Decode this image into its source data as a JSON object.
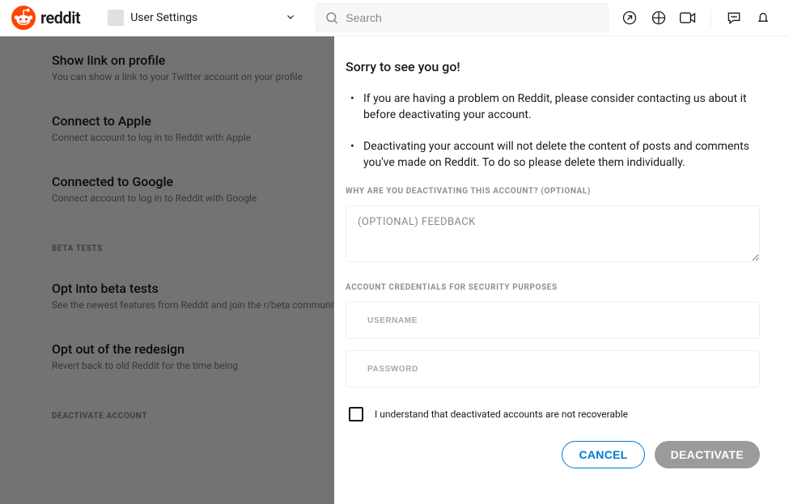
{
  "brand": {
    "name": "reddit"
  },
  "nav": {
    "label": "User Settings"
  },
  "search": {
    "placeholder": "Search"
  },
  "settings": {
    "item0": {
      "title": "Show link on profile",
      "desc": "You can show a link to your Twitter account on your profile"
    },
    "item1": {
      "title": "Connect to Apple",
      "desc": "Connect account to log in to Reddit with Apple"
    },
    "item2": {
      "title": "Connected to Google",
      "desc": "Connect account to log in to Reddit with Google"
    },
    "section_beta": "BETA TESTS",
    "item3": {
      "title": "Opt into beta tests",
      "desc": "See the newest features from Reddit and join the r/beta community"
    },
    "item4": {
      "title": "Opt out of the redesign",
      "desc": "Revert back to old Reddit for the time being"
    },
    "section_deactivate": "DEACTIVATE ACCOUNT"
  },
  "modal": {
    "title": "Sorry to see you go!",
    "bullet1": "If you are having a problem on Reddit, please consider contacting us about it before deactivating your account.",
    "bullet2": "Deactivating your account will not delete the content of posts and comments you've made on Reddit. To do so please delete them individually.",
    "feedback_label": "WHY ARE YOU DEACTIVATING THIS ACCOUNT? (OPTIONAL)",
    "feedback_placeholder": "(OPTIONAL) FEEDBACK",
    "credentials_label": "ACCOUNT CREDENTIALS FOR SECURITY PURPOSES",
    "username_placeholder": "USERNAME",
    "password_placeholder": "PASSWORD",
    "checkbox_label": "I understand that deactivated accounts are not recoverable",
    "cancel": "CANCEL",
    "deactivate": "DEACTIVATE"
  }
}
